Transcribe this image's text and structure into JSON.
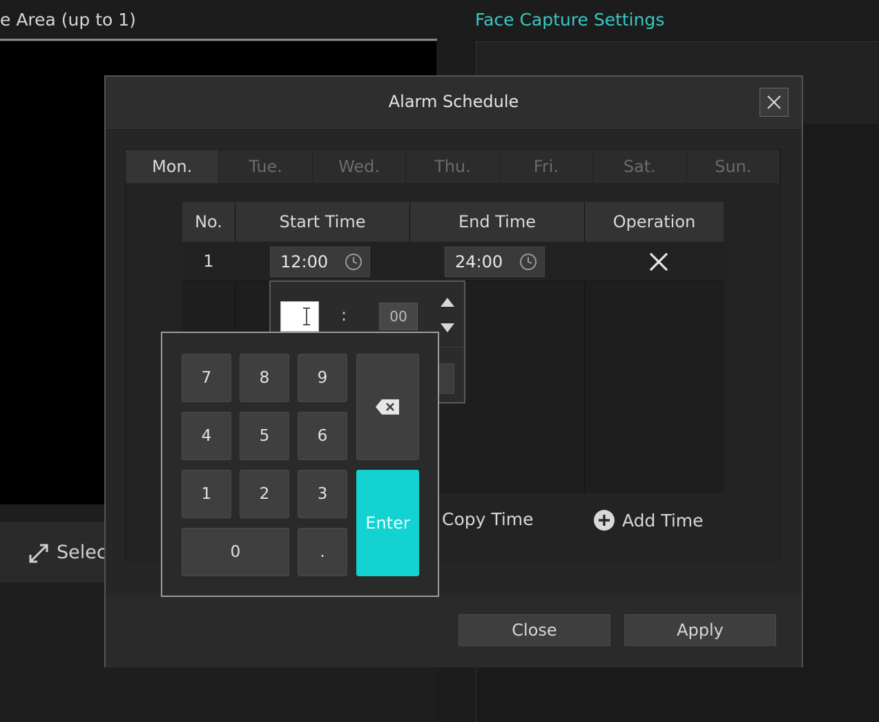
{
  "background": {
    "left_title": "e Area (up to 1)",
    "right_title": "Face Capture Settings",
    "select_label": "Selec"
  },
  "dialog": {
    "title": "Alarm Schedule",
    "tabs": [
      {
        "label": "Mon.",
        "active": true
      },
      {
        "label": "Tue.",
        "active": false
      },
      {
        "label": "Wed.",
        "active": false
      },
      {
        "label": "Thu.",
        "active": false
      },
      {
        "label": "Fri.",
        "active": false
      },
      {
        "label": "Sat.",
        "active": false
      },
      {
        "label": "Sun.",
        "active": false
      }
    ],
    "table": {
      "headers": [
        "No.",
        "Start Time",
        "End Time",
        "Operation"
      ],
      "rows": [
        {
          "no": "1",
          "start": "12:00",
          "end": "24:00"
        }
      ]
    },
    "copy_time_label": "Copy Time",
    "add_time_label": "Add Time",
    "close_label": "Close",
    "apply_label": "Apply"
  },
  "time_picker": {
    "hour_value": "",
    "separator": ":",
    "minute_value": "00"
  },
  "keypad": {
    "keys": [
      "7",
      "8",
      "9",
      "4",
      "5",
      "6",
      "1",
      "2",
      "3",
      "0",
      "."
    ],
    "enter_label": "Enter"
  },
  "colors": {
    "accent": "#12d3d2",
    "title_accent": "#37c9c5"
  }
}
